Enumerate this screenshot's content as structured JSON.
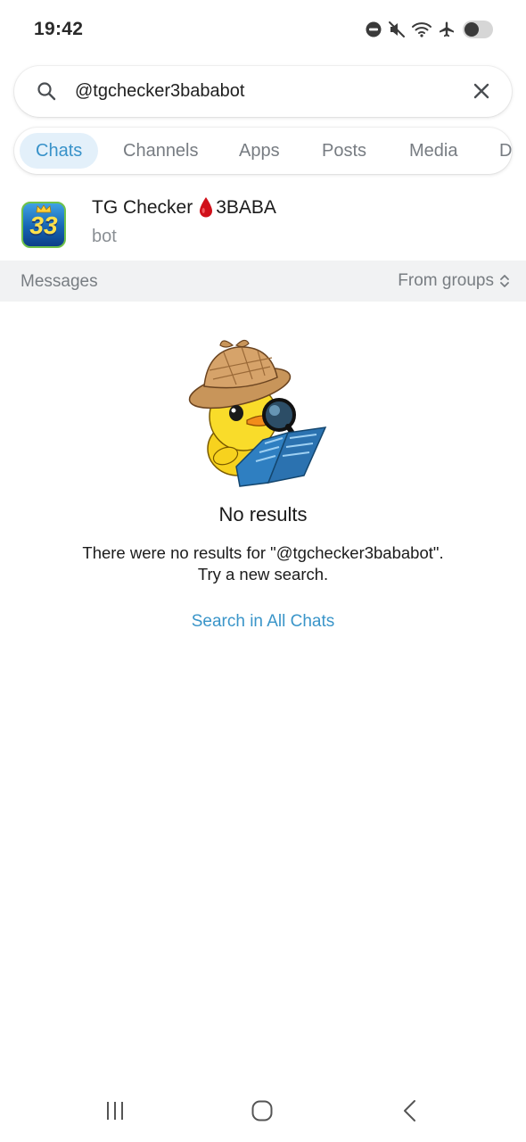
{
  "status_bar": {
    "time": "19:42",
    "icons": [
      "dnd-icon",
      "mute-icon",
      "wifi-icon",
      "airplane-icon",
      "battery-icon"
    ]
  },
  "search": {
    "query": "@tgchecker3bababot",
    "placeholder": "Search"
  },
  "tabs": [
    {
      "label": "Chats",
      "active": true
    },
    {
      "label": "Channels",
      "active": false
    },
    {
      "label": "Apps",
      "active": false
    },
    {
      "label": "Posts",
      "active": false
    },
    {
      "label": "Media",
      "active": false
    },
    {
      "label": "D",
      "active": false
    }
  ],
  "chat_result": {
    "title_left": "TG Checker",
    "title_right": "3BABA",
    "subtitle": "bot",
    "avatar_text": "33"
  },
  "messages_header": {
    "label": "Messages",
    "filter": "From groups"
  },
  "empty_state": {
    "title": "No results",
    "line1": "There were no results for \"@tgchecker3bababot\".",
    "line2": "Try a new search.",
    "link": "Search in All Chats"
  },
  "colors": {
    "accent": "#3892c9",
    "tab_active_bg": "#e3f0fa",
    "section_bg": "#f1f2f3",
    "muted_text": "#787d82"
  }
}
